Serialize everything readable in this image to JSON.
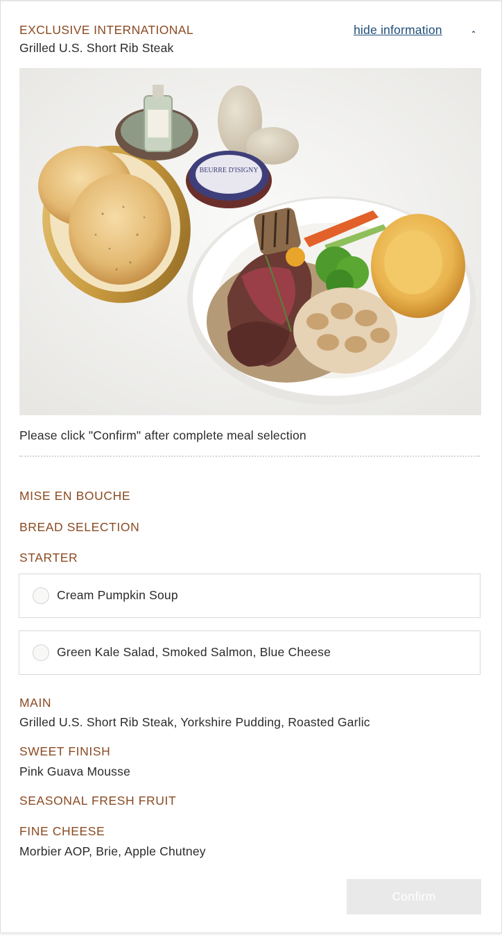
{
  "header": {
    "category": "EXCLUSIVE INTERNATIONAL",
    "dish": "Grilled U.S. Short Rib Steak",
    "hide_link": "hide information",
    "hide_icon": "chevron-up-icon"
  },
  "photo": {
    "jar_label": "BEURRE D'ISIGNY"
  },
  "notice": "Please click \"Confirm\" after complete meal selection",
  "sections": {
    "mise_en_bouche": "MISE EN BOUCHE",
    "bread_selection": "BREAD SELECTION",
    "starter": "STARTER",
    "main": "MAIN",
    "main_text": "Grilled U.S. Short Rib Steak, Yorkshire Pudding, Roasted Garlic",
    "sweet_finish": "SWEET FINISH",
    "sweet_finish_text": "Pink Guava Mousse",
    "seasonal_fruit": "SEASONAL FRESH FRUIT",
    "fine_cheese": "FINE CHEESE",
    "fine_cheese_text": "Morbier AOP, Brie, Apple Chutney"
  },
  "starter_options": [
    {
      "label": "Cream Pumpkin Soup",
      "selected": false
    },
    {
      "label": "Green Kale Salad, Smoked Salmon, Blue Cheese",
      "selected": false
    }
  ],
  "confirm_label": "Confirm",
  "colors": {
    "accent": "#8a4a22",
    "link": "#1f4e79",
    "disabled_button": "#e9e9e9"
  }
}
